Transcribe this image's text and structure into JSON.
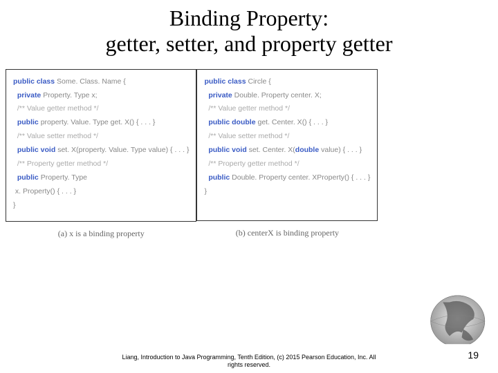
{
  "title_line1": "Binding Property:",
  "title_line2": "getter, setter, and property getter",
  "left": {
    "l1a": "public class ",
    "l1b": "Some. Class. Name {",
    "l2a": "private ",
    "l2b": "Property. Type x;",
    "l3": "/** Value getter method */",
    "l4a": "public ",
    "l4b": "property. Value. Type get. X() { . . . }",
    "l5": "/** Value setter method */",
    "l6a": "public void ",
    "l6b": "set. X(property. Value. Type value) { . . . }",
    "l7": "/** Property getter method */",
    "l8a": "public ",
    "l8b": "Property. Type",
    "l9": " x. Property() { . . . }",
    "l10": "}",
    "caption": "(a) x is a binding property"
  },
  "right": {
    "l1a": "public class ",
    "l1b": "Circle {",
    "l2a": "private ",
    "l2b": "Double. Property center. X;",
    "l3": "/** Value getter method */",
    "l4a": "public double ",
    "l4b": "get. Center. X() { . . . }",
    "l5": "/** Value setter method */",
    "l6a": "public void ",
    "l6b": "set. Center. X(",
    "l6c": "double ",
    "l6d": "value) { . . . }",
    "l7": "/** Property getter method */",
    "l8a": "public ",
    "l8b": "Double. Property center. XProperty() { . . . }",
    "l9": "}",
    "caption": "(b) centerX is binding property"
  },
  "footer_line1": "Liang, Introduction to Java Programming, Tenth Edition, (c) 2015 Pearson Education, Inc. All",
  "footer_line2": "rights reserved.",
  "page_number": "19"
}
